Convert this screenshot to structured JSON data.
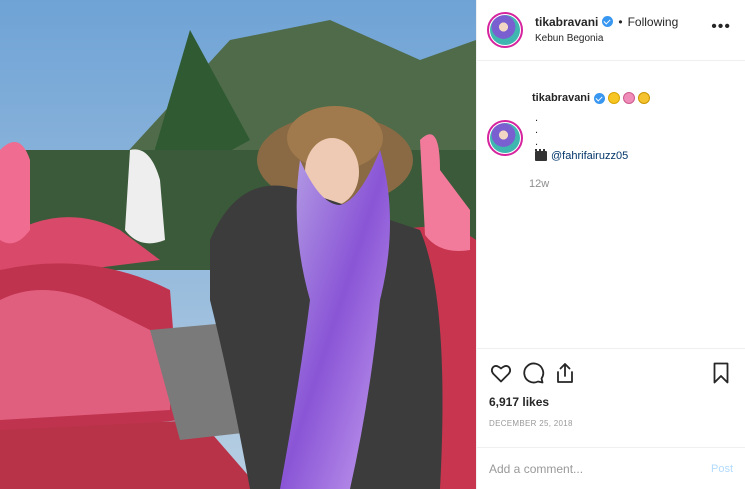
{
  "header": {
    "username": "tikabravani",
    "dot": "•",
    "following": "Following",
    "location": "Kebun Begonia",
    "more": "•••"
  },
  "caption": {
    "username": "tikabravani",
    "lines": [
      ".",
      ".",
      "."
    ],
    "mention": "@fahrifairuzz05",
    "time_ago": "12w"
  },
  "actions": {
    "likes": "6,917 likes",
    "date": "December 25, 2018"
  },
  "comment": {
    "placeholder": "Add a comment...",
    "post_label": "Post"
  },
  "colors": {
    "verified": "#3897f0",
    "mention": "#003569",
    "post_disabled": "#b3dbff",
    "avatar_ring": "#d6249f"
  },
  "icons": [
    "heart-icon",
    "comment-icon",
    "share-icon",
    "bookmark-icon",
    "verified-icon",
    "clapper-icon"
  ]
}
